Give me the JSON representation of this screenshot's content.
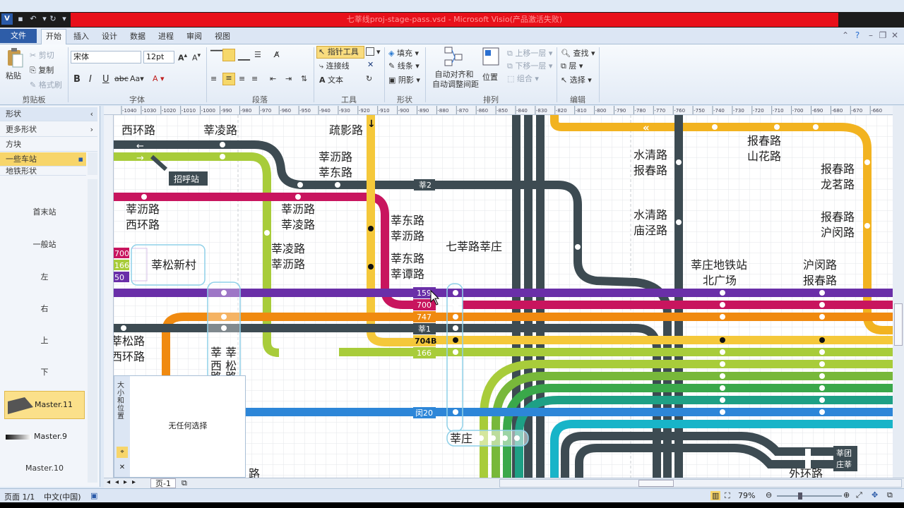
{
  "window": {
    "title": "七莘线proj-stage-pass.vsd - Microsoft Visio(产品激活失败)",
    "app_icon": "V"
  },
  "tabs": {
    "file": "文件",
    "items": [
      "开始",
      "插入",
      "设计",
      "数据",
      "进程",
      "审阅",
      "视图"
    ]
  },
  "ribbon": {
    "clipboard": {
      "paste": "粘贴",
      "cut": "剪切",
      "copy": "复制",
      "format_painter": "格式刷",
      "label": "剪贴板"
    },
    "font": {
      "name": "宋体",
      "size": "12pt",
      "label": "字体"
    },
    "paragraph": {
      "label": "段落"
    },
    "tools": {
      "pointer": "指针工具",
      "connector": "连接线",
      "text": "文本",
      "label": "工具"
    },
    "shape": {
      "fill": "填充",
      "line": "线条",
      "shadow": "阴影",
      "label": "形状"
    },
    "arrange": {
      "auto_align": "自动对齐和",
      "auto_space": "自动调整间距",
      "position": "位置",
      "bring_forward": "上移一层",
      "send_backward": "下移一层",
      "group": "组合",
      "label": "排列"
    },
    "editing": {
      "find": "查找",
      "layers": "层",
      "select": "选择",
      "label": "编辑"
    }
  },
  "shapes_panel": {
    "header": "形状",
    "more_shapes": "更多形状",
    "stencils": [
      "方块",
      "一些车站",
      "地铁形状"
    ],
    "masters": [
      "首末站",
      "一般站",
      "左",
      "右",
      "上",
      "下",
      "Master.11",
      "Master.9",
      "Master.10"
    ]
  },
  "size_panel": {
    "title": "大小和位置",
    "message": "无任何选择"
  },
  "ruler_ticks": [
    "-1040",
    "-1030",
    "-1020",
    "-1010",
    "-1000",
    "-990",
    "-980",
    "-970",
    "-960",
    "-950",
    "-940",
    "-930",
    "-920",
    "-910",
    "-900",
    "-890",
    "-880",
    "-870",
    "-860",
    "-850",
    "-840",
    "-830",
    "-820",
    "-810",
    "-800",
    "-790",
    "-780",
    "-770",
    "-760",
    "-750",
    "-740",
    "-730",
    "-720",
    "-710",
    "-700",
    "-690",
    "-680",
    "-670",
    "-660"
  ],
  "diagram": {
    "labels": {
      "l1": "西环路",
      "l2": "莘凌路",
      "l3": "疏影路",
      "l4a": "莘沥路",
      "l4b": "莘东路",
      "l5": "招呼站",
      "l6a": "莘沥路",
      "l6b": "西环路",
      "l7a": "莘沥路",
      "l7b": "莘凌路",
      "l8a": "莘东路",
      "l8b": "莘沥路",
      "l9a": "莘凌路",
      "l9b": "莘沥路",
      "l10": "莘松新村",
      "l11a": "莘东路",
      "l11b": "莘谭路",
      "l12": "七莘路莘庄",
      "l13a": "水清路",
      "l13b": "报春路",
      "l14a": "报春路",
      "l14b": "山花路",
      "l15a": "报春路",
      "l15b": "龙茗路",
      "l16a": "水清路",
      "l16b": "庙泾路",
      "l17a": "报春路",
      "l17b": "沪闵路",
      "l18a": "莘庄地铁站",
      "l18b": "北广场",
      "l19a": "沪闵路",
      "l19b": "报春路",
      "l20a": "莘松路",
      "l20b": "西环路",
      "l21": "莘庄",
      "l22a": "莘团",
      "l22b": "庄莘",
      "l23": "外环路",
      "l24": "路",
      "l25a": "莘 莘",
      "l25b": "西 松",
      "l25c": "路 路"
    },
    "route_badges": {
      "b1": "莘2",
      "b2": "159",
      "b3": "700",
      "b4": "747",
      "b5": "莘1",
      "b6": "704B",
      "b7": "166",
      "b8": "闵20",
      "left1": "700",
      "left2": "166",
      "left3": "50"
    },
    "line_colors": {
      "purple": "#6a2fa8",
      "magenta": "#c8155e",
      "orange": "#f08a10",
      "dark": "#3d4b52",
      "yellow": "#f5c83a",
      "lime": "#a8cc3a",
      "green": "#78b83a",
      "green2": "#3aa84a",
      "teal": "#1ea085",
      "blue": "#2d86d8",
      "cyan": "#18b4c8",
      "gold": "#f2b320"
    }
  },
  "page_tab": "页-1",
  "status": {
    "page": "页面 1/1",
    "lang": "中文(中国)",
    "zoom": "79%"
  }
}
